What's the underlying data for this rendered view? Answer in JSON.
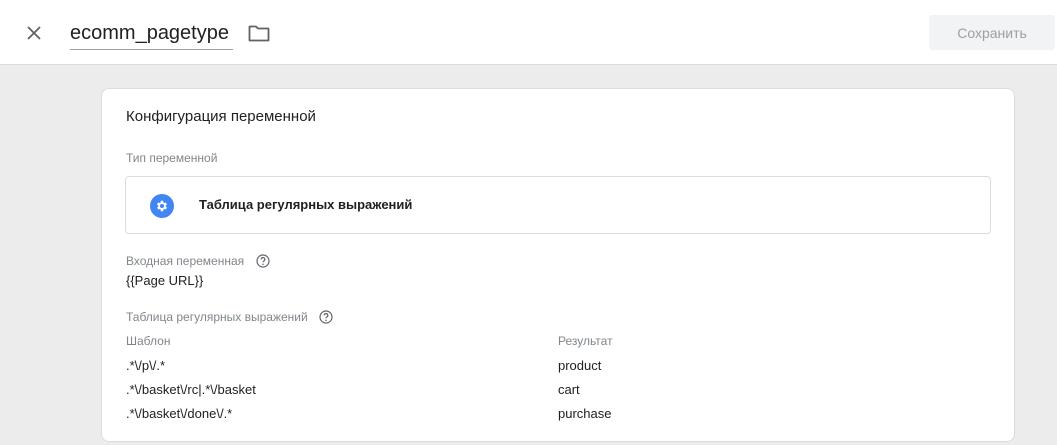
{
  "header": {
    "title": "ecomm_pagetype",
    "save_label": "Сохранить"
  },
  "config": {
    "title": "Конфигурация переменной",
    "type_label": "Тип переменной",
    "type_name": "Таблица регулярных выражений",
    "input_label": "Входная переменная",
    "input_value": "{{Page URL}}",
    "table_label": "Таблица регулярных выражений",
    "columns": {
      "pattern": "Шаблон",
      "result": "Результат"
    },
    "rows": [
      {
        "pattern": ".*\\/p\\/.*",
        "result": "product"
      },
      {
        "pattern": ".*\\/basket\\/rc|.*\\/basket",
        "result": "cart"
      },
      {
        "pattern": ".*\\/basket\\/done\\/.*",
        "result": "purchase"
      }
    ]
  },
  "colors": {
    "accent": "#4285f4",
    "background": "#ececec"
  },
  "icons": [
    "close-icon",
    "folder-icon",
    "gear-icon",
    "help-icon"
  ]
}
